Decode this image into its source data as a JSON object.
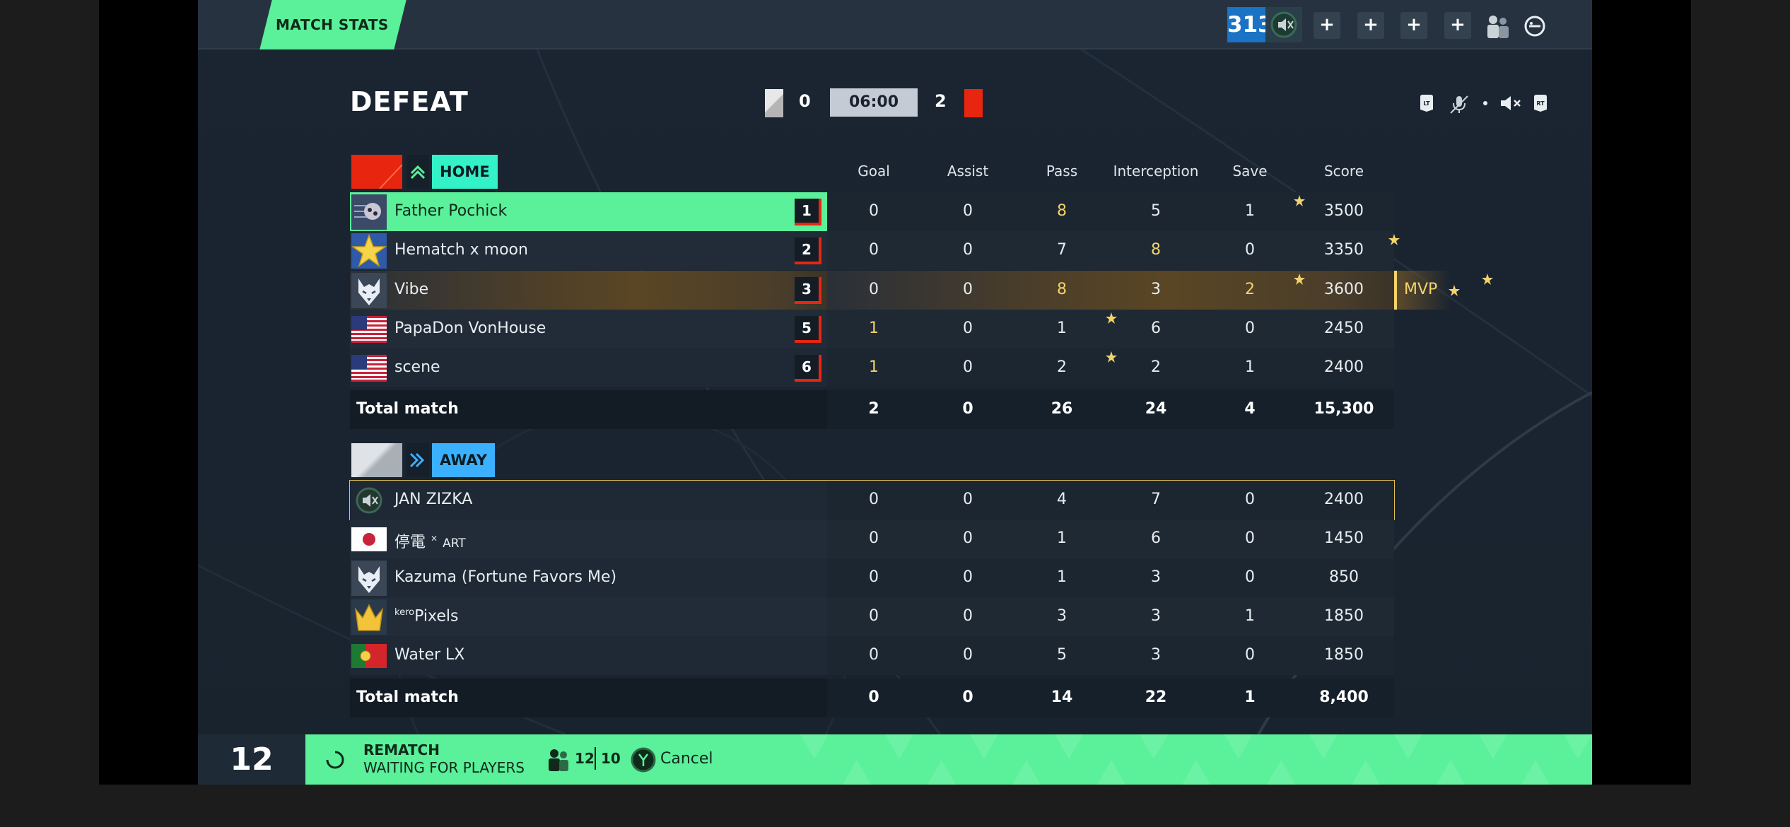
{
  "topbar": {
    "tab_label": "MATCH STATS",
    "level": "313"
  },
  "header": {
    "result": "DEFEAT",
    "home_score": "0",
    "timer": "06:00",
    "away_score": "2",
    "buttons": {
      "lt": "LT",
      "rt": "RT"
    }
  },
  "columns": [
    "Goal",
    "Assist",
    "Pass",
    "Interception",
    "Save",
    "Score"
  ],
  "home": {
    "label": "HOME",
    "players": [
      {
        "name": "Father Pochick",
        "rank": "1",
        "goal": "0",
        "assist": "0",
        "pass": "8",
        "interception": "5",
        "save": "1",
        "score": "3500"
      },
      {
        "name": "Hematch x moon",
        "rank": "2",
        "goal": "0",
        "assist": "0",
        "pass": "7",
        "interception": "8",
        "save": "0",
        "score": "3350"
      },
      {
        "name": "Vibe",
        "rank": "3",
        "goal": "0",
        "assist": "0",
        "pass": "8",
        "interception": "3",
        "save": "2",
        "score": "3600"
      },
      {
        "name": "PapaDon VonHouse",
        "rank": "5",
        "goal": "1",
        "assist": "0",
        "pass": "1",
        "interception": "6",
        "save": "0",
        "score": "2450"
      },
      {
        "name": "scene",
        "rank": "6",
        "goal": "1",
        "assist": "0",
        "pass": "2",
        "interception": "2",
        "save": "1",
        "score": "2400"
      }
    ],
    "total": {
      "label": "Total match",
      "goal": "2",
      "assist": "0",
      "pass": "26",
      "interception": "24",
      "save": "4",
      "score": "15,300"
    }
  },
  "mvp_label": "MVP",
  "away": {
    "label": "AWAY",
    "players": [
      {
        "name": "JAN ZIZKA",
        "goal": "0",
        "assist": "0",
        "pass": "4",
        "interception": "7",
        "save": "0",
        "score": "2400"
      },
      {
        "name": "停電",
        "name_suffix": "ART",
        "goal": "0",
        "assist": "0",
        "pass": "1",
        "interception": "6",
        "save": "0",
        "score": "1450"
      },
      {
        "name": "Kazuma (Fortune Favors Me)",
        "goal": "0",
        "assist": "0",
        "pass": "1",
        "interception": "3",
        "save": "0",
        "score": "850"
      },
      {
        "name_prefix": "kero",
        "name": "Pixels",
        "goal": "0",
        "assist": "0",
        "pass": "3",
        "interception": "3",
        "save": "1",
        "score": "1850"
      },
      {
        "name": "Water LX",
        "goal": "0",
        "assist": "0",
        "pass": "5",
        "interception": "3",
        "save": "0",
        "score": "1850"
      }
    ],
    "total": {
      "label": "Total match",
      "goal": "0",
      "assist": "0",
      "pass": "14",
      "interception": "22",
      "save": "1",
      "score": "8,400"
    }
  },
  "bottom": {
    "countdown": "12",
    "rematch_title": "REMATCH",
    "rematch_status": "WAITING FOR PLAYERS",
    "players_ready": "12",
    "players_total": "10",
    "cancel_label": "Cancel"
  },
  "colors": {
    "accent_green": "#5bf09a",
    "home_red": "#e8260f",
    "away_blue": "#3bb0ff",
    "mvp_gold": "#f3d36b",
    "background": "#1b2531"
  },
  "icons": [
    "mute-icon",
    "plus-icon",
    "party-icon",
    "controller-icon",
    "lt-button-icon",
    "rt-button-icon",
    "mic-off-icon",
    "speaker-mute-icon",
    "star-icon",
    "spinner-icon",
    "y-button-icon",
    "players-icon"
  ]
}
